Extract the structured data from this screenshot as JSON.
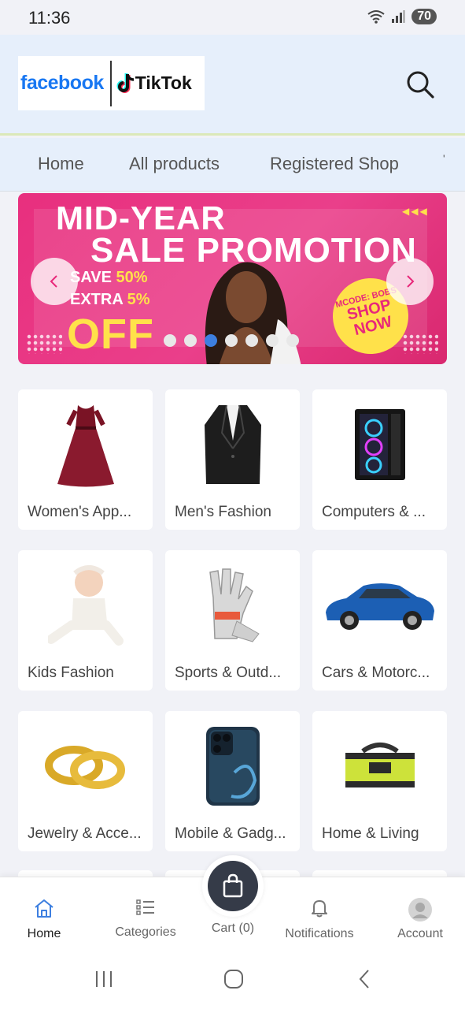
{
  "status_bar": {
    "time": "11:36",
    "battery": "70"
  },
  "header": {
    "logo_facebook": "facebook",
    "logo_tiktok": "TikTok"
  },
  "nav_tabs": [
    "Home",
    "All products",
    "Registered Shop"
  ],
  "banner": {
    "title_line1": "MID-YEAR",
    "title_line2": "SALE PROMOTION",
    "save_text": "SAVE ",
    "save_value": "50%",
    "extra_text": "EXTRA ",
    "extra_value": "5%",
    "off_text": "OFF",
    "code_text": "MCODE: BOBS",
    "shop_now": "SHOP NOW",
    "slide_count": 7,
    "active_slide": 3
  },
  "categories": [
    {
      "label": "Women's App...",
      "icon": "dress-icon"
    },
    {
      "label": "Men's Fashion",
      "icon": "blazer-icon"
    },
    {
      "label": "Computers & ...",
      "icon": "pc-tower-icon"
    },
    {
      "label": "Kids Fashion",
      "icon": "baby-icon"
    },
    {
      "label": "Sports & Outd...",
      "icon": "gloves-icon"
    },
    {
      "label": "Cars & Motorc...",
      "icon": "car-icon"
    },
    {
      "label": "Jewelry & Acce...",
      "icon": "rings-icon"
    },
    {
      "label": "Mobile & Gadg...",
      "icon": "phone-icon"
    },
    {
      "label": "Home & Living",
      "icon": "toolbag-icon"
    }
  ],
  "bottom_nav": {
    "home": "Home",
    "categories": "Categories",
    "cart": "Cart (0)",
    "notifications": "Notifications",
    "account": "Account"
  },
  "colors": {
    "accent": "#3d7fe0",
    "header_bg": "#e6effb",
    "banner_pink": "#e82f7e",
    "banner_yellow": "#ffe14a",
    "cart_dark": "#353b48"
  }
}
